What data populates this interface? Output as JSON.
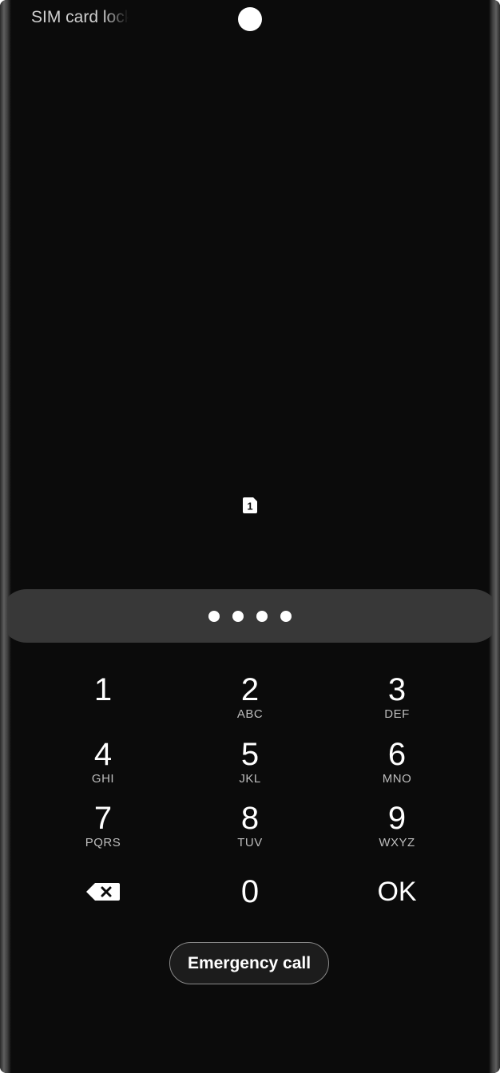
{
  "status": {
    "title": "SIM card locked"
  },
  "sim": {
    "slot_number": "1"
  },
  "pin_entry": {
    "entered_digits_count": 4
  },
  "keypad": {
    "keys": [
      {
        "digit": "1",
        "letters": ""
      },
      {
        "digit": "2",
        "letters": "ABC"
      },
      {
        "digit": "3",
        "letters": "DEF"
      },
      {
        "digit": "4",
        "letters": "GHI"
      },
      {
        "digit": "5",
        "letters": "JKL"
      },
      {
        "digit": "6",
        "letters": "MNO"
      },
      {
        "digit": "7",
        "letters": "PQRS"
      },
      {
        "digit": "8",
        "letters": "TUV"
      },
      {
        "digit": "9",
        "letters": "WXYZ"
      }
    ],
    "backspace_icon": "backspace-icon",
    "zero": "0",
    "ok_label": "OK"
  },
  "emergency": {
    "label": "Emergency call"
  },
  "colors": {
    "background": "#0b0b0b",
    "pin_bar": "#383838",
    "text": "#ffffff",
    "secondary_text": "#bdbdbd"
  }
}
